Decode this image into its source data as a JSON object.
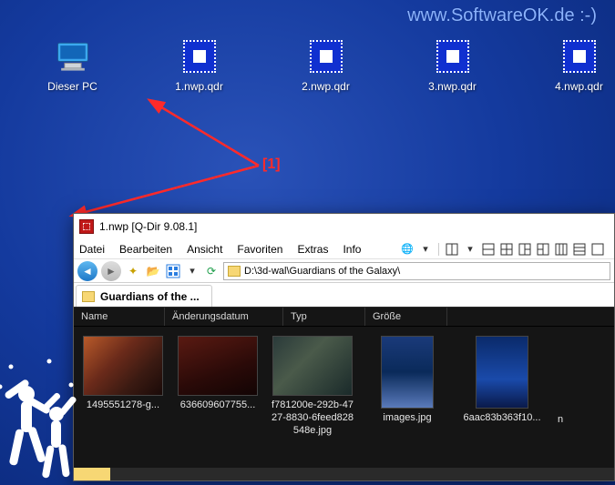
{
  "watermark": "www.SoftwareOK.de :-)",
  "desktop": {
    "icons": [
      {
        "label": "Dieser PC",
        "kind": "pc"
      },
      {
        "label": "1.nwp.qdr",
        "kind": "qdr"
      },
      {
        "label": "2.nwp.qdr",
        "kind": "qdr"
      },
      {
        "label": "3.nwp.qdr",
        "kind": "qdr"
      },
      {
        "label": "4.nwp.qdr",
        "kind": "qdr"
      }
    ]
  },
  "annotation": {
    "label": "[1]"
  },
  "window": {
    "title": "1.nwp   [Q-Dir 9.08.1]",
    "menu": [
      "Datei",
      "Bearbeiten",
      "Ansicht",
      "Favoriten",
      "Extras",
      "Info"
    ],
    "address": "D:\\3d-wal\\Guardians of the Galaxy\\",
    "tab": "Guardians of the ...",
    "columns": [
      "Name",
      "Änderungsdatum",
      "Typ",
      "Größe"
    ],
    "files": [
      {
        "name": "1495551278-g...",
        "poster": false
      },
      {
        "name": "636609607755...",
        "poster": false
      },
      {
        "name": "f781200e-292b-4727-8830-6feed828548e.jpg",
        "poster": false
      },
      {
        "name": "images.jpg",
        "poster": true
      },
      {
        "name": "6aac83b363f10...",
        "poster": true
      }
    ],
    "partial_right": "n"
  }
}
